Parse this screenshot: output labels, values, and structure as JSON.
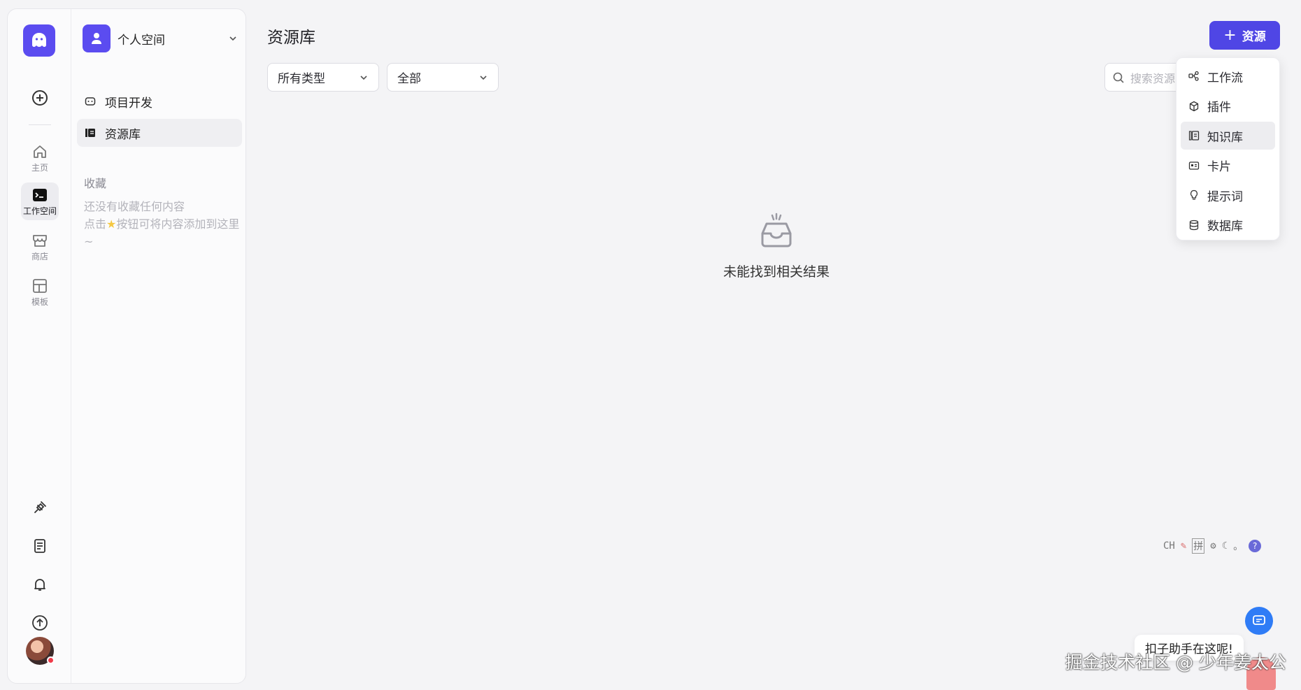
{
  "rail": {
    "items": [
      {
        "label": "主页"
      },
      {
        "label": "工作空间"
      },
      {
        "label": "商店"
      },
      {
        "label": "模板"
      }
    ]
  },
  "sidebar": {
    "space_name": "个人空间",
    "nav": [
      {
        "label": "项目开发"
      },
      {
        "label": "资源库"
      }
    ],
    "favorites_title": "收藏",
    "favorites_empty_line1": "还没有收藏任何内容",
    "favorites_empty_line2_pre": "点击",
    "favorites_empty_line2_post": "按钮可将内容添加到这里~"
  },
  "main": {
    "title": "资源库",
    "type_filter": "所有类型",
    "scope_filter": "全部",
    "search_placeholder": "搜索资源",
    "add_button": "资源",
    "empty_text": "未能找到相关结果"
  },
  "dropdown": {
    "items": [
      {
        "label": "工作流",
        "icon": "workflow-icon"
      },
      {
        "label": "插件",
        "icon": "plugin-icon"
      },
      {
        "label": "知识库",
        "icon": "knowledge-icon"
      },
      {
        "label": "卡片",
        "icon": "card-icon"
      },
      {
        "label": "提示词",
        "icon": "prompt-icon"
      },
      {
        "label": "数据库",
        "icon": "database-icon"
      }
    ],
    "highlighted": "知识库"
  },
  "ime": {
    "mode": "CH",
    "pinyin": "拼"
  },
  "assistant": {
    "bubble": "扣子助手在这呢!"
  },
  "watermark": "掘金技术社区 @ 少年姜太公",
  "colors": {
    "brand": "#4f46e5",
    "logo": "#5b4cf0",
    "chat": "#2f7cf6"
  }
}
